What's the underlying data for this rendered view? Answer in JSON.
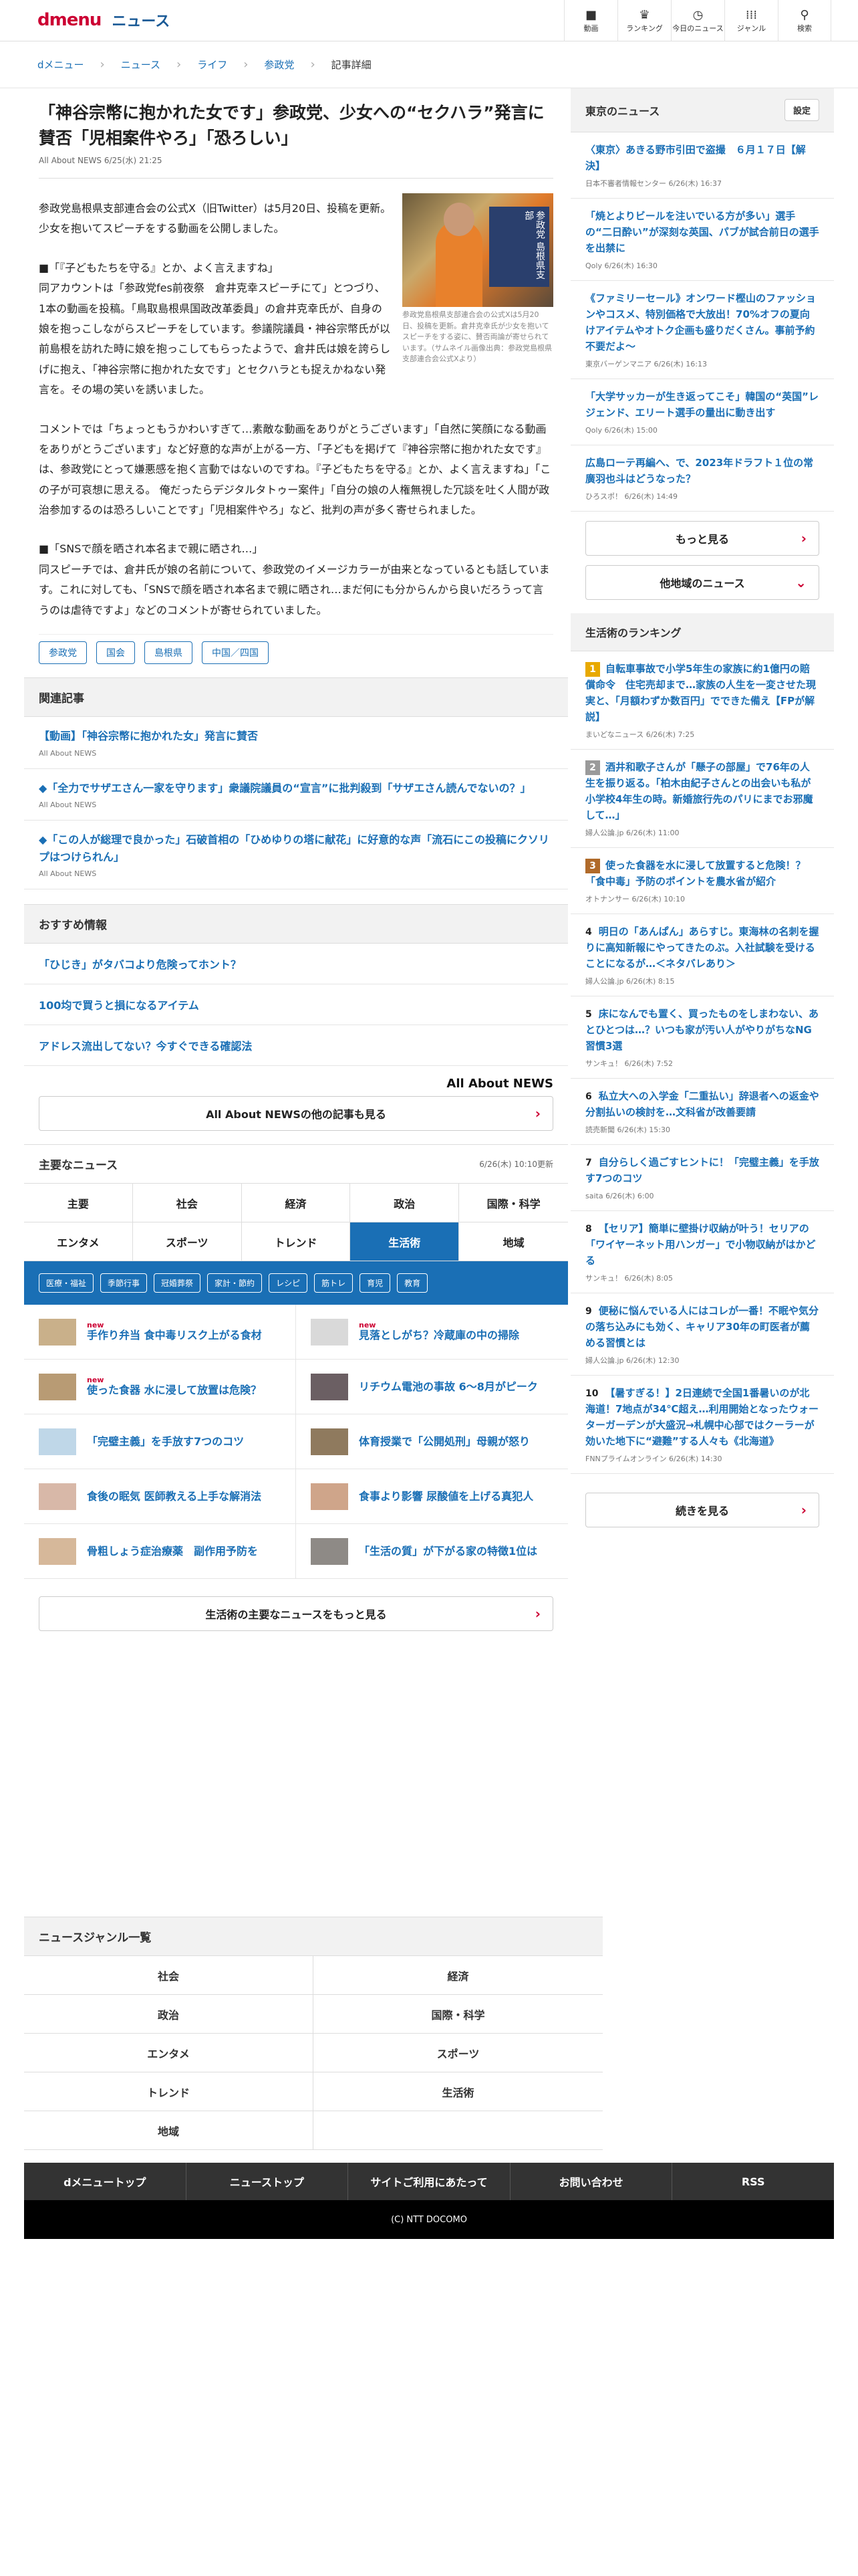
{
  "header": {
    "logo_main": "dmenu",
    "logo_sub": "ニュース",
    "nav": [
      {
        "label": "動画",
        "icon": "video-icon"
      },
      {
        "label": "ランキング",
        "icon": "trophy-icon"
      },
      {
        "label": "今日のニュース",
        "icon": "clock-icon"
      },
      {
        "label": "ジャンル",
        "icon": "grid-icon"
      },
      {
        "label": "検索",
        "icon": "search-icon"
      }
    ]
  },
  "breadcrumb": [
    "dメニュー",
    "ニュース",
    "ライフ",
    "参政党",
    "記事詳細"
  ],
  "article": {
    "title": "「神谷宗幣に抱かれた女です」参政党、少女への“セクハラ”発言に賛否「児相案件やろ」「恐ろしい」",
    "meta": "All About NEWS 6/25(水) 21:25",
    "photo_caption": "参政党島根県支部連合会の公式Xは5月20日、投稿を更新。倉井克幸氏が少女を抱いてスピーチをする姿に、賛否両論が寄せられています。（サムネイル画像出典：参政党島根県支部連合会公式Xより）",
    "photo_sign": "参政党 島根県支部",
    "p1": "参政党島根県支部連合会の公式X（旧Twitter）は5月20日、投稿を更新。少女を抱いてスピーチをする動画を公開しました。",
    "h1": "■「『子どもたちを守る』とか、よく言えますね」",
    "p2": "同アカウントは「参政党fes前夜祭　倉井克幸スピーチにて」とつづり、1本の動画を投稿。「鳥取島根県国政改革委員」の倉井克幸氏が、自身の娘を抱っこしながらスピーチをしています。参議院議員・神谷宗幣氏が以前島根を訪れた時に娘を抱っこしてもらったようで、倉井氏は娘を誇らしげに抱え、「神谷宗幣に抱かれた女です」とセクハラとも捉えかねない発言を。その場の笑いを誘いました。",
    "p3": "コメントでは「ちょっともうかわいすぎて…素敵な動画をありがとうございます」「自然に笑顔になる動画をありがとうございます」など好意的な声が上がる一方、「子どもを掲げて『神谷宗幣に抱かれた女です』は、参政党にとって嫌悪感を抱く言動ではないのですね。『子どもたちを守る』とか、よく言えますね」「この子が可哀想に思える。 俺だったらデジタルタトゥー案件」「自分の娘の人権無視した冗談を吐く人間が政治参加するのは恐ろしいことです」「児相案件やろ」など、批判の声が多く寄せられました。",
    "h2": "■「SNSで顔を晒され本名まで親に晒され…」",
    "p4": "同スピーチでは、倉井氏が娘の名前について、参政党のイメージカラーが由来となっているとも話しています。これに対しても、「SNSで顔を晒され本名まで親に晒され…まだ何にも分からんから良いだろうって言うのは虐待ですよ」などのコメントが寄せられていました。",
    "tags": [
      "参政党",
      "国会",
      "島根県",
      "中国／四国"
    ]
  },
  "related": {
    "heading": "関連記事",
    "items": [
      {
        "title": "【動画】「神谷宗幣に抱かれた女」発言に賛否",
        "source": "All About NEWS"
      },
      {
        "title": "◆「全力でサザエさん一家を守ります」衆議院議員の“宣言”に批判殺到「サザエさん読んでないの？」",
        "source": "All About NEWS"
      },
      {
        "title": "◆「この人が総理で良かった」石破首相の「ひめゆりの塔に献花」に好意的な声「流石にこの投稿にクソリプはつけられん」",
        "source": "All About NEWS"
      }
    ]
  },
  "recommend": {
    "heading": "おすすめ情報",
    "items": [
      "「ひじき」がタバコより危険ってホント？",
      "100均で買うと損になるアイテム",
      "アドレス流出してない？今すぐできる確認法"
    ],
    "brand": "All About NEWS",
    "more_button": "All About NEWSの他の記事も見る"
  },
  "main_news": {
    "heading": "主要なニュース",
    "date": "6/26(木) 10:10更新",
    "categories": [
      "主要",
      "社会",
      "経済",
      "政治",
      "国際・科学",
      "エンタメ",
      "スポーツ",
      "トレンド",
      "生活術",
      "地域"
    ],
    "active_category": "生活術",
    "subcategories": [
      "医療・福祉",
      "季節行事",
      "冠婚葬祭",
      "家計・節約",
      "レシピ",
      "筋トレ",
      "育児",
      "教育"
    ],
    "items": [
      {
        "title": "手作り弁当 食中毒リスク上がる食材",
        "new": "new"
      },
      {
        "title": "見落としがち？冷蔵庫の中の掃除",
        "new": "new"
      },
      {
        "title": "使った食器 水に浸して放置は危険？",
        "new": "new"
      },
      {
        "title": "リチウム電池の事故 6～8月がピーク",
        "new": ""
      },
      {
        "title": "「完璧主義」を手放す7つのコツ",
        "new": ""
      },
      {
        "title": "体育授業で「公開処刑」母親が怒り",
        "new": ""
      },
      {
        "title": "食後の眠気 医師教える上手な解消法",
        "new": ""
      },
      {
        "title": "食事より影響 尿酸値を上げる真犯人",
        "new": ""
      },
      {
        "title": "骨粗しょう症治療薬　副作用予防を",
        "new": ""
      },
      {
        "title": "「生活の質」が下がる家の特徴1位は",
        "new": ""
      }
    ],
    "more_button": "生活術の主要なニュースをもっと見る"
  },
  "sidebar": {
    "local_heading": "東京のニュース",
    "settings_label": "設定",
    "local_items": [
      {
        "title": "〈東京〉あきる野市引田で盗撮　６月１７日【解決】",
        "source": "日本不審者情報センター 6/26(木) 16:37"
      },
      {
        "title": "「焼とよりビールを注いでいる方が多い」選手の“二日酔い”が深刻な英国、パブが試合前日の選手を出禁に",
        "source": "Qoly 6/26(木) 16:30"
      },
      {
        "title": "《ファミリーセール》オンワード樫山のファッションやコスメ、特別価格で大放出！70%オフの夏向けアイテムやオトク企画も盛りだくさん。事前予約不要だよ～",
        "source": "東京バーゲンマニア 6/26(木) 16:13"
      },
      {
        "title": "「大学サッカーが生き返ってこそ」韓国の“英国”レジェンド、エリート選手の量出に動き出す",
        "source": "Qoly 6/26(木) 15:00"
      },
      {
        "title": "広島ローテ再編へ、で、2023年ドラフト１位の常廣羽也斗はどうなった？",
        "source": "ひろスポ！ 6/26(木) 14:49"
      }
    ],
    "local_more": "もっと見る",
    "other_region": "他地域のニュース",
    "ranking_heading": "生活術のランキング",
    "ranking": [
      {
        "rank": "1",
        "title": "自転車事故で小学5年生の家族に約1億円の賠償命令　住宅売却まで…家族の人生を一変させた現実と、「月額わずか数百円」でできた備え【FPが解説】",
        "source": "まいどなニュース 6/26(木) 7:25"
      },
      {
        "rank": "2",
        "title": "酒井和歌子さんが「懸子の部屋」で76年の人生を振り返る。「柏木由紀子さんとの出会いも私が小学校4年生の時。新婚旅行先のパリにまでお邪魔して…」",
        "source": "婦人公論.jp 6/26(木) 11:00"
      },
      {
        "rank": "3",
        "title": "使った食器を水に浸して放置すると危険！？「食中毒」予防のポイントを農水省が紹介",
        "source": "オトナンサー 6/26(木) 10:10"
      },
      {
        "rank": "4",
        "title": "明日の「あんぱん」あらすじ。東海林の名刺を握りに高知新報にやってきたのぶ。入社試験を受けることになるが…＜ネタバレあり＞",
        "source": "婦人公論.jp 6/26(木) 8:15"
      },
      {
        "rank": "5",
        "title": "床になんでも置く、買ったものをしまわない、あとひとつは…？いつも家が汚い人がやりがちなNG習慣3選",
        "source": "サンキュ！ 6/26(木) 7:52"
      },
      {
        "rank": "6",
        "title": "私立大への入学金「二重払い」辞退者への返金や分割払いの検討を…文科省が改善要請",
        "source": "読売新聞 6/26(木) 15:30"
      },
      {
        "rank": "7",
        "title": "自分らしく過ごすヒントに！「完璧主義」を手放す7つのコツ",
        "source": "saita 6/26(木) 6:00"
      },
      {
        "rank": "8",
        "title": "【セリア】簡単に壁掛け収納が叶う！セリアの「ワイヤーネット用ハンガー」で小物収納がはかどる",
        "source": "サンキュ！ 6/26(木) 8:05"
      },
      {
        "rank": "9",
        "title": "便秘に悩んでいる人にはコレが一番！不眠や気分の落ち込みにも効く、キャリア30年の町医者が薦める習慣とは",
        "source": "婦人公論.jp 6/26(木) 12:30"
      },
      {
        "rank": "10",
        "title": "【暑すぎる！】2日連続で全国1番暑いのが北海道！7地点が34℃超え…利用開始となったウォーターガーデンが大盛況→札幌中心部ではクーラーが効いた地下に“避難”する人々も《北海道》",
        "source": "FNNプライムオンライン 6/26(木) 14:30"
      }
    ],
    "ranking_more": "続きを見る"
  },
  "genre_list": {
    "heading": "ニュースジャンル一覧",
    "items": [
      "社会",
      "経済",
      "政治",
      "国際・科学",
      "エンタメ",
      "スポーツ",
      "トレンド",
      "生活術",
      "地域",
      ""
    ]
  },
  "footer": {
    "nav": [
      "dメニュートップ",
      "ニューストップ",
      "サイトご利用にあたって",
      "お問い合わせ",
      "RSS"
    ],
    "copyright": "(C) NTT DOCOMO"
  }
}
